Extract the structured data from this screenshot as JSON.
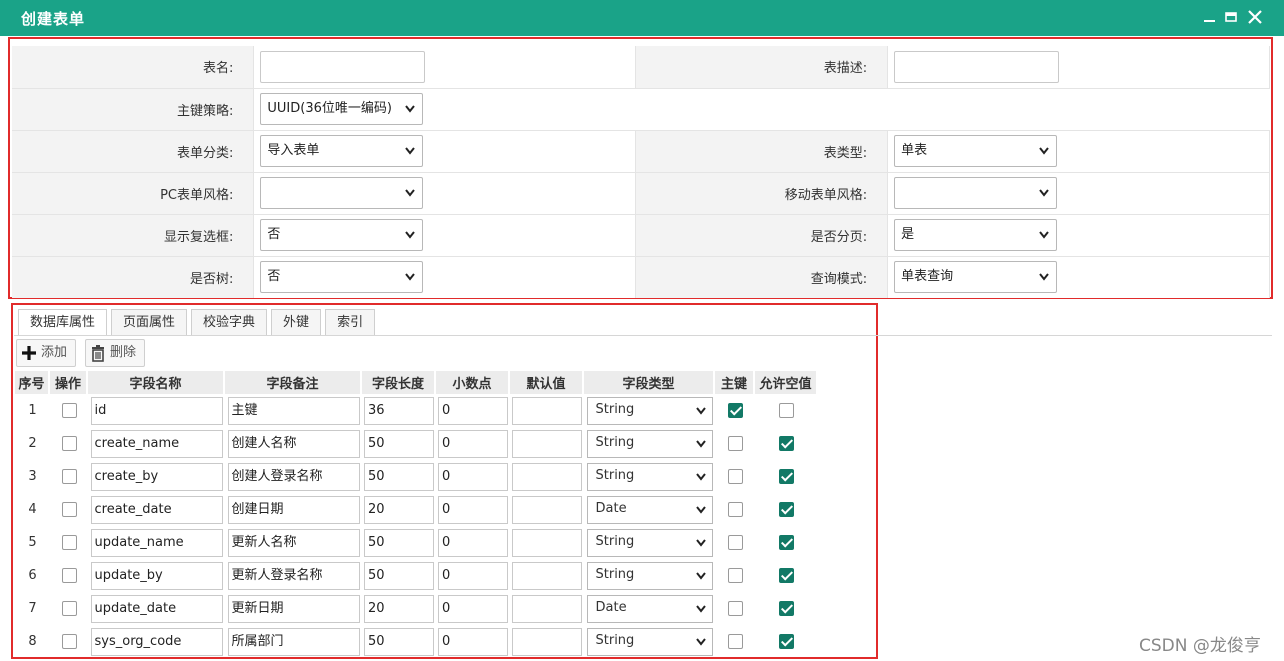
{
  "window": {
    "title": "创建表单"
  },
  "form": {
    "table_name_label": "表名:",
    "table_name_value": "",
    "table_desc_label": "表描述:",
    "table_desc_value": "",
    "pk_strategy_label": "主键策略:",
    "pk_strategy_value": "UUID(36位唯一编码)",
    "category_label": "表单分类:",
    "category_value": "导入表单",
    "table_type_label": "表类型:",
    "table_type_value": "单表",
    "pc_style_label": "PC表单风格:",
    "pc_style_value": "",
    "mobile_style_label": "移动表单风格:",
    "mobile_style_value": "",
    "show_checkbox_label": "显示复选框:",
    "show_checkbox_value": "否",
    "paging_label": "是否分页:",
    "paging_value": "是",
    "tree_label": "是否树:",
    "tree_value": "否",
    "query_mode_label": "查询模式:",
    "query_mode_value": "单表查询"
  },
  "tabs": [
    "数据库属性",
    "页面属性",
    "校验字典",
    "外键",
    "索引"
  ],
  "toolbar": {
    "add_label": "添加",
    "delete_label": "删除"
  },
  "grid": {
    "headers": [
      "序号",
      "操作",
      "字段名称",
      "字段备注",
      "字段长度",
      "小数点",
      "默认值",
      "字段类型",
      "主键",
      "允许空值"
    ],
    "rows": [
      {
        "no": "1",
        "name": "id",
        "comment": "主键",
        "length": "36",
        "decimal": "0",
        "default": "",
        "type": "String",
        "pk": true,
        "nullable": false
      },
      {
        "no": "2",
        "name": "create_name",
        "comment": "创建人名称",
        "length": "50",
        "decimal": "0",
        "default": "",
        "type": "String",
        "pk": false,
        "nullable": true
      },
      {
        "no": "3",
        "name": "create_by",
        "comment": "创建人登录名称",
        "length": "50",
        "decimal": "0",
        "default": "",
        "type": "String",
        "pk": false,
        "nullable": true
      },
      {
        "no": "4",
        "name": "create_date",
        "comment": "创建日期",
        "length": "20",
        "decimal": "0",
        "default": "",
        "type": "Date",
        "pk": false,
        "nullable": true
      },
      {
        "no": "5",
        "name": "update_name",
        "comment": "更新人名称",
        "length": "50",
        "decimal": "0",
        "default": "",
        "type": "String",
        "pk": false,
        "nullable": true
      },
      {
        "no": "6",
        "name": "update_by",
        "comment": "更新人登录名称",
        "length": "50",
        "decimal": "0",
        "default": "",
        "type": "String",
        "pk": false,
        "nullable": true
      },
      {
        "no": "7",
        "name": "update_date",
        "comment": "更新日期",
        "length": "20",
        "decimal": "0",
        "default": "",
        "type": "Date",
        "pk": false,
        "nullable": true
      },
      {
        "no": "8",
        "name": "sys_org_code",
        "comment": "所属部门",
        "length": "50",
        "decimal": "0",
        "default": "",
        "type": "String",
        "pk": false,
        "nullable": true
      }
    ]
  },
  "watermark": "CSDN @龙俊亨",
  "colors": {
    "titlebar": "#1aa388",
    "highlight_border": "#e12b2b",
    "checkbox_on": "#127966"
  }
}
